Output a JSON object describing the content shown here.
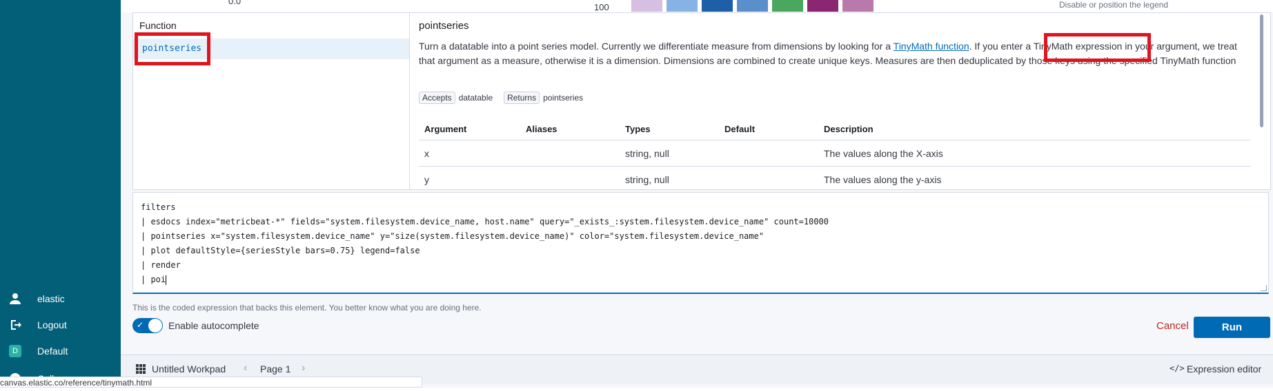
{
  "sidebar": {
    "user": "elastic",
    "logout": "Logout",
    "space_initial": "D",
    "space": "Default",
    "partial_item": "Coll"
  },
  "chart_strip": {
    "tick_left": "0.0",
    "tick_mid": "100",
    "bar_colors": [
      "#d6bfe0",
      "#86b3e3",
      "#1f5fa8",
      "#5a8fcc",
      "#49a85d",
      "#8a2672",
      "#b97aab"
    ],
    "legend_hint": "Disable or position the legend"
  },
  "reference": {
    "list_header": "Function",
    "selected_function": "pointseries",
    "title": "pointseries",
    "desc_part1": "Turn a datatable into a point series model. Currently we differentiate measure from dimensions by looking for a ",
    "desc_link": "TinyMath function",
    "desc_part2": ". If you enter a TinyMath expression in your argument, we treat that argument as a measure, otherwise it is a dimension. Dimensions are combined to create unique keys. Measures are then deduplicated by those keys using the specified TinyMath function",
    "accepts_label": "Accepts",
    "accepts_value": "datatable",
    "returns_label": "Returns",
    "returns_value": "pointseries",
    "columns": [
      "Argument",
      "Aliases",
      "Types",
      "Default",
      "Description"
    ],
    "rows": [
      {
        "argument": "x",
        "aliases": "",
        "types": "string, null",
        "default": "",
        "description": "The values along the X-axis"
      },
      {
        "argument": "y",
        "aliases": "",
        "types": "string, null",
        "default": "",
        "description": "The values along the y-axis"
      }
    ]
  },
  "editor": {
    "lines": [
      "filters",
      "| esdocs index=\"metricbeat-*\" fields=\"system.filesystem.device_name, host.name\" query=\"_exists_:system.filesystem.device_name\" count=10000",
      "| pointseries x=\"system.filesystem.device_name\" y=\"size(system.filesystem.device_name)\" color=\"system.filesystem.device_name\"",
      "| plot defaultStyle={seriesStyle bars=0.75} legend=false",
      "| render",
      "| poi"
    ],
    "help_text": "This is the coded expression that backs this element. You better know what you are doing here.",
    "autocomplete_label": "Enable autocomplete",
    "autocomplete_enabled": true,
    "cancel_label": "Cancel",
    "run_label": "Run"
  },
  "workpad": {
    "title": "Untitled Workpad",
    "page_label": "Page 1",
    "expression_editor_label": "Expression editor"
  },
  "status_url": "canvas.elastic.co/reference/tinymath.html",
  "colors": {
    "sidebar_bg": "#025f77",
    "accent": "#006bb4",
    "danger": "#bd271e",
    "highlight": "#e0141e"
  }
}
